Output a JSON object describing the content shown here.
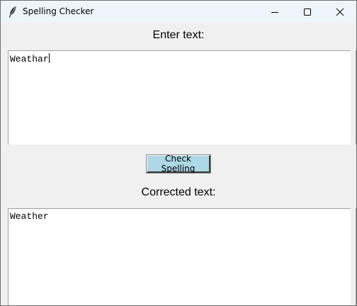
{
  "window": {
    "title": "Spelling Checker",
    "titlebar_color": "#eef5fa",
    "icons": {
      "app": "feather-icon",
      "minimize": "minimize-icon",
      "maximize": "maximize-icon",
      "close": "close-icon"
    }
  },
  "input_section": {
    "label": "Enter text:",
    "value": "Weathar"
  },
  "action": {
    "check_label": "Check Spelling",
    "button_color": "#add8e6"
  },
  "output_section": {
    "label": "Corrected text:",
    "value": "Weather"
  }
}
